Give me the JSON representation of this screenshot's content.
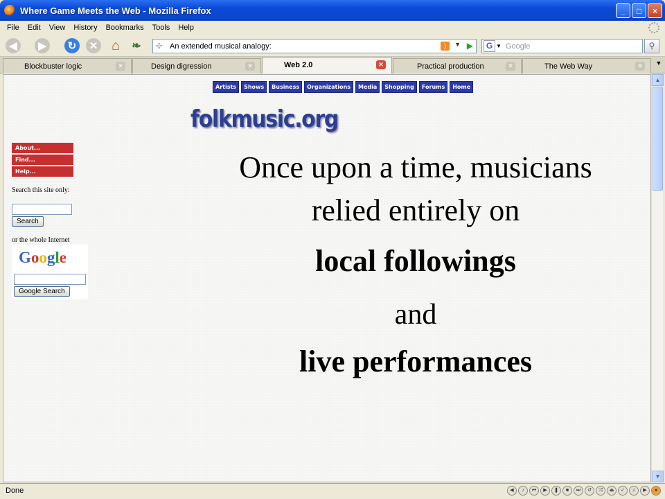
{
  "window": {
    "title": "Where Game Meets the Web - Mozilla Firefox",
    "buttons": [
      "_",
      "□",
      "×"
    ]
  },
  "menubar": {
    "items": [
      "File",
      "Edit",
      "View",
      "History",
      "Bookmarks",
      "Tools",
      "Help"
    ]
  },
  "navbar": {
    "url": "An extended musical analogy:",
    "search_placeholder": "Google"
  },
  "tabs": [
    {
      "label": "Blockbuster logic",
      "active": false
    },
    {
      "label": "Design digression",
      "active": false
    },
    {
      "label": "Web 2.0",
      "active": true
    },
    {
      "label": "Practical production",
      "active": false
    },
    {
      "label": "The Web Way",
      "active": false
    }
  ],
  "page": {
    "top_nav": [
      "Artists",
      "Shows",
      "Business",
      "Organizations",
      "Media",
      "Shopping",
      "Forums",
      "Home"
    ],
    "logo": "folkmusic.org",
    "side_buttons": [
      "About...",
      "Find...",
      "Help..."
    ],
    "search_site_label": "Search this site only:",
    "search_button": "Search",
    "whole_internet_label": "or the whole Internet",
    "google_logo": [
      "G",
      "o",
      "o",
      "g",
      "l",
      "e"
    ],
    "google_search_button": "Google Search",
    "slide": {
      "line1": "Once upon a time, musicians",
      "line2": "relied entirely on",
      "line3": "local followings",
      "line4": "and",
      "line5": "live performances"
    }
  },
  "statusbar": {
    "text": "Done"
  }
}
